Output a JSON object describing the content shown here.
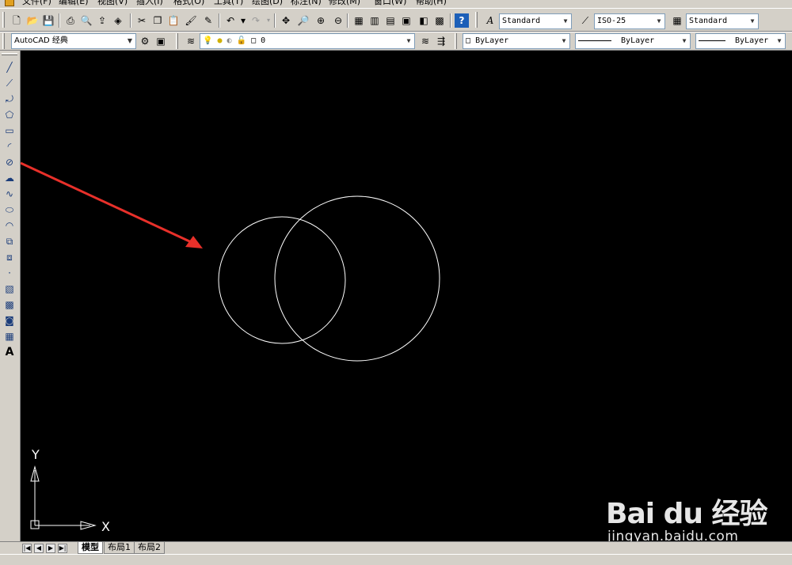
{
  "menu": [
    "文件(F)",
    "编辑(E)",
    "视图(V)",
    "插入(I)",
    "格式(O)",
    "工具(T)",
    "绘图(D)",
    "标注(N)",
    "修改(M)",
    "窗口(W)",
    "帮助(H)"
  ],
  "styles": {
    "text_style": "Standard",
    "dim_style": "ISO-25",
    "table_style": "Standard"
  },
  "workspace": "AutoCAD 经典",
  "layer": "0",
  "properties": {
    "color": "ByLayer",
    "linetype": "ByLayer",
    "lineweight": "ByLayer"
  },
  "ucs": {
    "x_label": "X",
    "y_label": "Y"
  },
  "layout_tabs": [
    "模型",
    "布局1",
    "布局2"
  ],
  "active_tab": 0,
  "left_tool_text": "A",
  "watermark": {
    "brand": "Bai du 经验",
    "url": "jingyan.baidu.com"
  },
  "colors": {
    "canvas": "#000000",
    "entity": "#ffffff",
    "annotation_arrow": "#e8302a"
  }
}
